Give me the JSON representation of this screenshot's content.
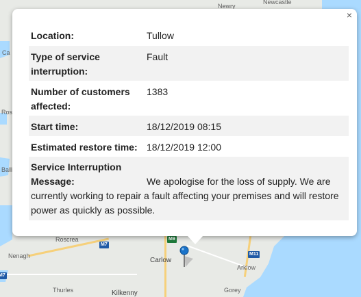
{
  "map": {
    "towns": {
      "newry": "Newry",
      "newcastle": "Newcastle",
      "ca": "Ca",
      "ros": "Ros",
      "balli": "Balli",
      "roscrea": "Roscrea",
      "nenagh": "Nenagh",
      "carlow": "Carlow",
      "arklow": "Arklow",
      "thurles": "Thurles",
      "kilkenny": "Kilkenny",
      "gorey": "Gorey"
    },
    "shields": {
      "m7": "M7",
      "m11": "M11",
      "m7b": "M7",
      "m9": "M9"
    },
    "colors": {
      "land": "#e8eae6",
      "sea": "#aadaff",
      "road": "#f6d07a",
      "marker": "#1a73c9"
    }
  },
  "popup": {
    "close_label": "×",
    "rows": [
      {
        "label": "Location:",
        "value": "Tullow"
      },
      {
        "label": "Type of service interruption:",
        "value": "Fault"
      },
      {
        "label": "Number of customers affected:",
        "value": "1383"
      },
      {
        "label": "Start time:",
        "value": "18/12/2019 08:15"
      },
      {
        "label": "Estimated restore time:",
        "value": "18/12/2019 12:00"
      }
    ],
    "message": {
      "label_line1": "Service Interruption",
      "label_line2": "Message:",
      "text": "We apologise for the loss of supply. We are currently working to repair a fault affecting your premises and will restore power as quickly as possible."
    }
  }
}
